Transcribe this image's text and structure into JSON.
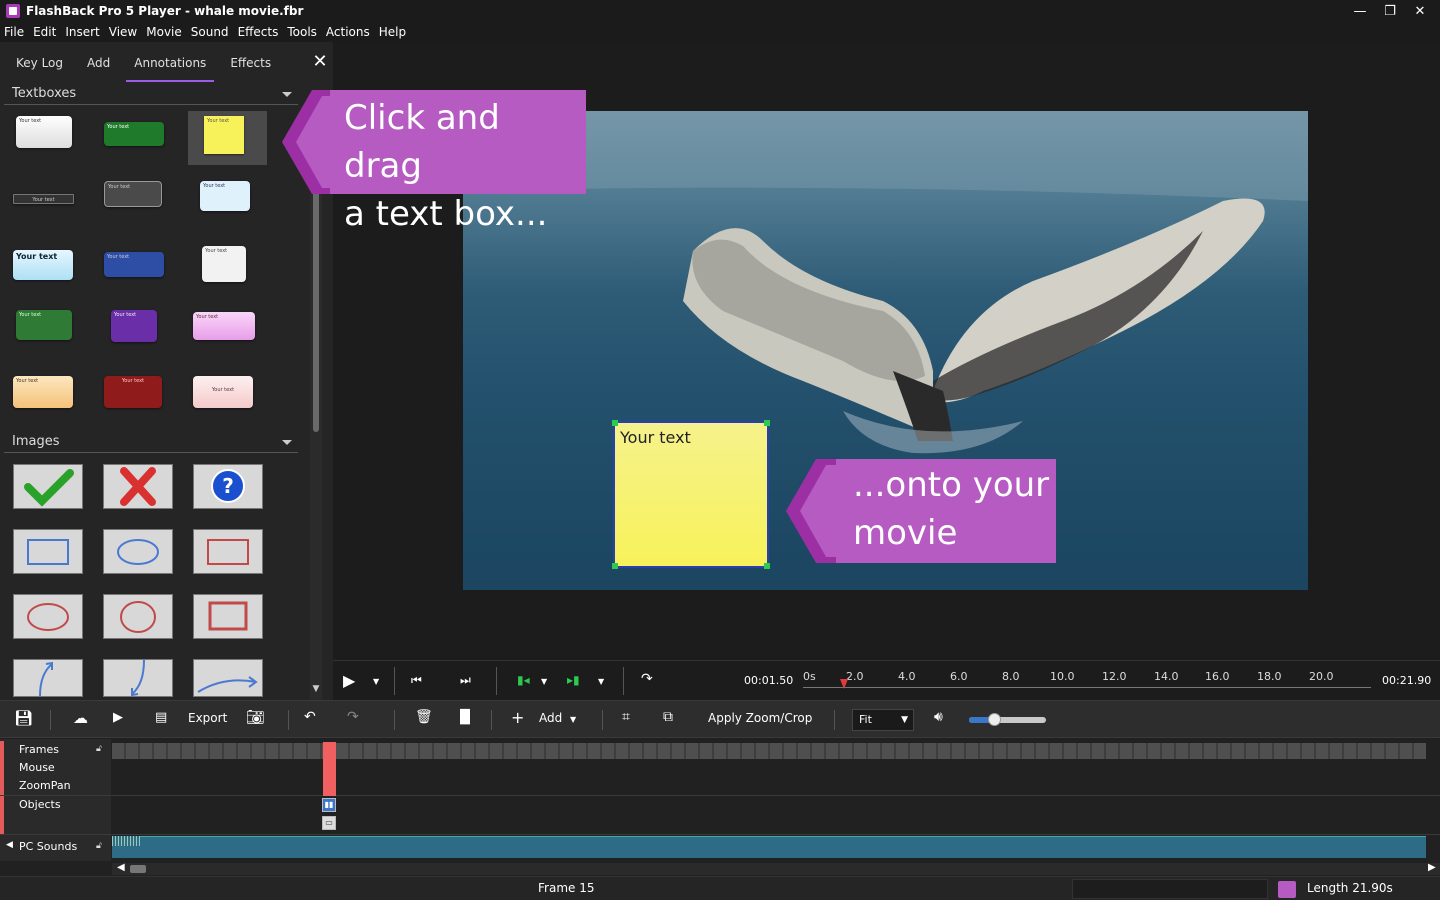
{
  "window": {
    "title": "FlashBack Pro 5 Player - whale movie.fbr",
    "min": "—",
    "max": "❐",
    "close": "✕"
  },
  "menu": [
    "File",
    "Edit",
    "Insert",
    "View",
    "Movie",
    "Sound",
    "Effects",
    "Tools",
    "Actions",
    "Help"
  ],
  "panel": {
    "tabs": [
      "Key Log",
      "Add",
      "Annotations",
      "Effects"
    ],
    "active_tab": "Annotations",
    "close": "✕",
    "sections": {
      "textboxes": "Textboxes",
      "images": "Images"
    },
    "textbox_label": "Your text"
  },
  "callouts": {
    "first": [
      "Click and drag",
      "a text box..."
    ],
    "second": [
      "...onto your",
      "movie"
    ]
  },
  "canvas": {
    "sticky_text": "Your text"
  },
  "transport": {
    "current_time": "00:01.50",
    "total_time": "00:21.90",
    "ruler": [
      "0s",
      "2.0",
      "4.0",
      "6.0",
      "8.0",
      "10.0",
      "12.0",
      "14.0",
      "16.0",
      "18.0",
      "20.0"
    ]
  },
  "toolbar": {
    "export": "Export",
    "add": "Add",
    "apply_zoom": "Apply Zoom/Crop",
    "zoom_select": "Fit",
    "volume": 0.3
  },
  "timeline": {
    "tracks": [
      "Frames",
      "Mouse",
      "ZoomPan",
      "Objects",
      "PC Sounds"
    ]
  },
  "status": {
    "frame": "Frame 15",
    "length": "Length 21.90s"
  },
  "colors": {
    "accent": "#b55bc2",
    "cursor": "#f06060",
    "sticky": "#f7f25a"
  }
}
